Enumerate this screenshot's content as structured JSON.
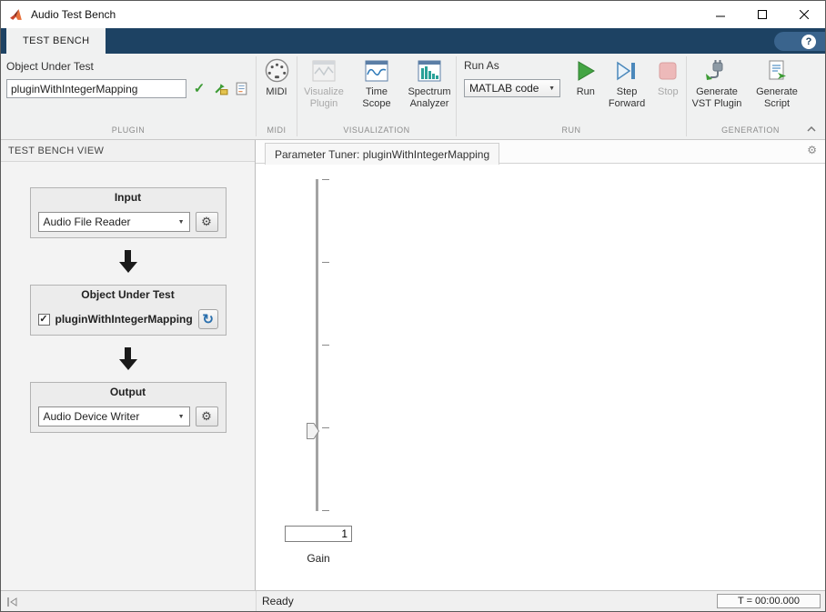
{
  "window": {
    "title": "Audio Test Bench"
  },
  "tabstrip": {
    "tab": "TEST BENCH",
    "help": "?"
  },
  "ribbon": {
    "plugin": {
      "field_label": "Object Under Test",
      "field_value": "pluginWithIntegerMapping",
      "section_label": "PLUGIN"
    },
    "midi": {
      "button_label": "MIDI",
      "section_label": "MIDI"
    },
    "visualization": {
      "visualize_plugin": "Visualize Plugin",
      "time_scope": "Time Scope",
      "spectrum_analyzer": "Spectrum Analyzer",
      "section_label": "VISUALIZATION"
    },
    "run": {
      "run_as_label": "Run As",
      "run_as_value": "MATLAB code",
      "run_label": "Run",
      "step_forward_label": "Step Forward",
      "stop_label": "Stop",
      "section_label": "RUN"
    },
    "generation": {
      "generate_vst": "Generate VST Plugin",
      "generate_script": "Generate Script",
      "section_label": "GENERATION"
    }
  },
  "left_panel": {
    "header": "TEST BENCH VIEW",
    "input_group": {
      "title": "Input",
      "dropdown_value": "Audio File Reader"
    },
    "out_group": {
      "title": "Object Under Test",
      "checkbox_label": "pluginWithIntegerMapping",
      "checked": true
    },
    "output_group": {
      "title": "Output",
      "dropdown_value": "Audio Device Writer"
    }
  },
  "main_panel": {
    "tab_title": "Parameter Tuner: pluginWithIntegerMapping",
    "gain": {
      "value": "1",
      "label": "Gain"
    }
  },
  "status_bar": {
    "status": "Ready",
    "time": "T = 00:00.000"
  },
  "icons": {
    "gear": "⚙",
    "dropdown_arrow": "▼",
    "check": "✓",
    "refresh": "↻"
  },
  "colors": {
    "tabstrip_bg": "#1d4263",
    "run_green": "#44a544",
    "stop_disabled": "#edb9b9",
    "accent_blue": "#2a6fad"
  }
}
